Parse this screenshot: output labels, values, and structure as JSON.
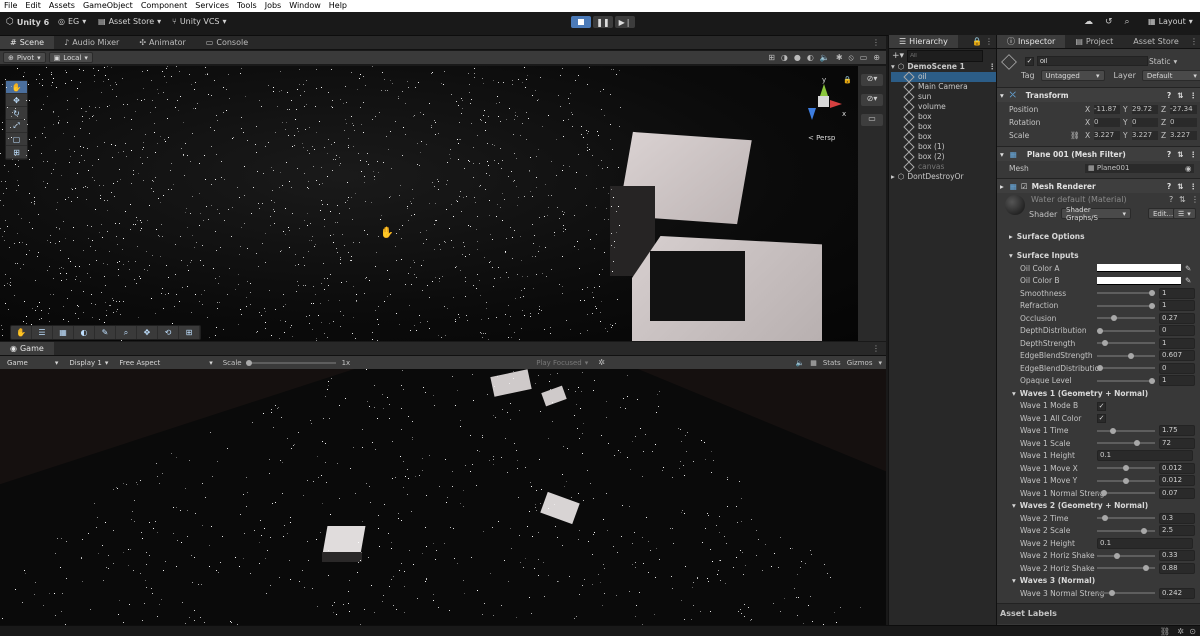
{
  "menubar": {
    "items": [
      "File",
      "Edit",
      "Assets",
      "GameObject",
      "Component",
      "Services",
      "Tools",
      "Jobs",
      "Window",
      "Help"
    ]
  },
  "toolbar": {
    "app_label": "Unity 6",
    "account": "EG",
    "asset_store": "Asset Store",
    "vcs": "Unity VCS",
    "layout": "Layout"
  },
  "scene_tabs": {
    "scene": "Scene",
    "audio_mixer": "Audio Mixer",
    "animator": "Animator",
    "console": "Console"
  },
  "scene_toolbar": {
    "pivot": "Pivot",
    "local": "Local"
  },
  "scene_view": {
    "persp": "< Persp",
    "gizmo_x": "x",
    "gizmo_y": "y"
  },
  "game_tab": {
    "label": "Game"
  },
  "game_toolbar": {
    "mode": "Game",
    "display": "Display 1",
    "aspect": "Free Aspect",
    "scale_label": "Scale",
    "scale_value": "1x",
    "play_focused": "Play Focused",
    "stats": "Stats",
    "gizmos": "Gizmos"
  },
  "hierarchy": {
    "tab": "Hierarchy",
    "search_placeholder": "All",
    "scene": "DemoScene 1",
    "items": [
      "oil",
      "Main Camera",
      "sun",
      "volume",
      "box",
      "box",
      "box",
      "box (1)",
      "box (2)",
      "canvas"
    ],
    "dont_destroy": "DontDestroyOr"
  },
  "inspector": {
    "tabs": {
      "inspector": "Inspector",
      "project": "Project",
      "asset_store": "Asset Store"
    },
    "object_name": "oil",
    "static": "Static",
    "tag_label": "Tag",
    "tag_value": "Untagged",
    "layer_label": "Layer",
    "layer_value": "Default",
    "transform": {
      "title": "Transform",
      "position_label": "Position",
      "px": "-11.87",
      "py": "29.72",
      "pz": "-27.34",
      "rotation_label": "Rotation",
      "rx": "0",
      "ry": "0",
      "rz": "0",
      "scale_label": "Scale",
      "sx": "3.227",
      "sy": "3.227",
      "sz": "3.227",
      "axis_x": "X",
      "axis_y": "Y",
      "axis_z": "Z"
    },
    "mesh_filter": {
      "title": "Plane 001 (Mesh Filter)",
      "mesh_label": "Mesh",
      "mesh_value": "Plane001"
    },
    "mesh_renderer": {
      "title": "Mesh Renderer"
    },
    "material": {
      "name": "Water default (Material)",
      "shader_label": "Shader",
      "shader_value": "Shader Graphs/S",
      "edit": "Edit..."
    },
    "surface_options": "Surface Options",
    "surface_inputs": "Surface Inputs",
    "properties": [
      {
        "label": "Oil Color A",
        "kind": "color"
      },
      {
        "label": "Oil Color B",
        "kind": "color"
      },
      {
        "label": "Smoothness",
        "kind": "slider",
        "value": "1",
        "pos": 1.0
      },
      {
        "label": "Refraction",
        "kind": "slider",
        "value": "1",
        "pos": 1.0
      },
      {
        "label": "Occlusion",
        "kind": "slider",
        "value": "0.27",
        "pos": 0.27
      },
      {
        "label": "DepthDistribution",
        "kind": "slider",
        "value": "0",
        "pos": 0.0
      },
      {
        "label": "DepthStrength",
        "kind": "slider",
        "value": "1",
        "pos": 0.1
      },
      {
        "label": "EdgeBlendStrength",
        "kind": "slider",
        "value": "0.607",
        "pos": 0.6
      },
      {
        "label": "EdgeBlendDistributio",
        "kind": "slider",
        "value": "0",
        "pos": 0.0
      },
      {
        "label": "Opaque Level",
        "kind": "slider",
        "value": "1",
        "pos": 1.0
      },
      {
        "label": "Waves 1 (Geometry + Normal)",
        "kind": "header"
      },
      {
        "label": "Wave 1 Mode B",
        "kind": "check"
      },
      {
        "label": "Wave 1 All Color",
        "kind": "check"
      },
      {
        "label": "Wave 1 Time",
        "kind": "slider",
        "value": "1.75",
        "pos": 0.25
      },
      {
        "label": "Wave 1 Scale",
        "kind": "slider",
        "value": "72",
        "pos": 0.72
      },
      {
        "label": "Wave 1 Height",
        "kind": "field",
        "value": "0.1"
      },
      {
        "label": "Wave 1 Move X",
        "kind": "slider",
        "value": "0.012",
        "pos": 0.5
      },
      {
        "label": "Wave 1 Move Y",
        "kind": "slider",
        "value": "0.012",
        "pos": 0.5
      },
      {
        "label": "Wave 1 Normal Streng",
        "kind": "slider",
        "value": "0.07",
        "pos": 0.07
      },
      {
        "label": "Waves 2 (Geometry + Normal)",
        "kind": "header"
      },
      {
        "label": "Wave 2 Time",
        "kind": "slider",
        "value": "0.3",
        "pos": 0.1
      },
      {
        "label": "Wave 2 Scale",
        "kind": "slider",
        "value": "2.5",
        "pos": 0.85
      },
      {
        "label": "Wave 2 Height",
        "kind": "field",
        "value": "0.1"
      },
      {
        "label": "Wave 2 Horiz Shake",
        "kind": "slider",
        "value": "0.33",
        "pos": 0.33
      },
      {
        "label": "Wave 2 Horiz Shake",
        "kind": "slider",
        "value": "0.88",
        "pos": 0.88
      },
      {
        "label": "Waves 3 (Normal)",
        "kind": "header"
      },
      {
        "label": "Wave 3 Normal Streng",
        "kind": "slider",
        "value": "0.242",
        "pos": 0.24
      }
    ],
    "asset_labels": "Asset Labels"
  }
}
